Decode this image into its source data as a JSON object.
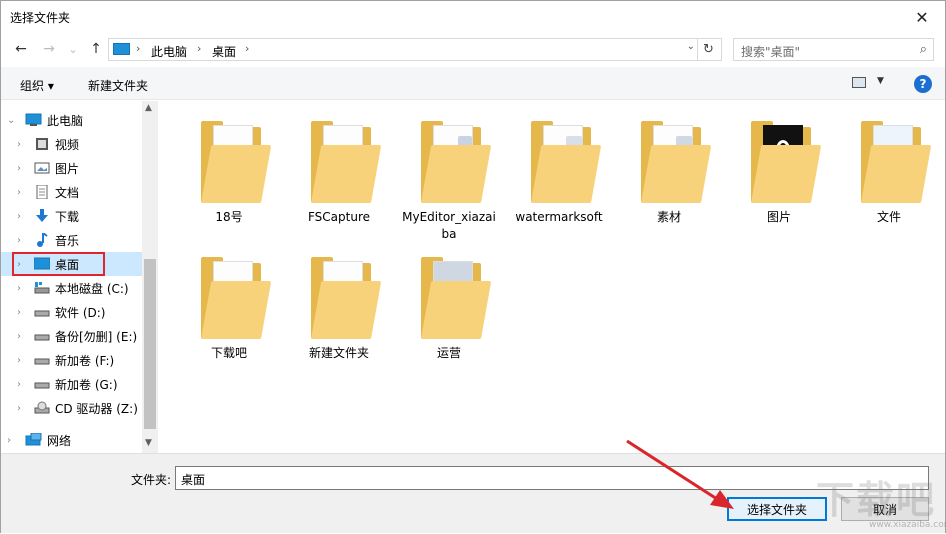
{
  "window": {
    "title": "选择文件夹",
    "close_glyph": "✕"
  },
  "nav": {
    "back_glyph": "←",
    "forward_glyph": "→",
    "recent_glyph": "⌄",
    "up_glyph": "↑",
    "breadcrumb": [
      "此电脑",
      "桌面"
    ],
    "sep_glyph": "›",
    "dropdown_glyph": "⌄",
    "refresh_glyph": "↻"
  },
  "search": {
    "placeholder": "搜索\"桌面\"",
    "icon_glyph": "⌕"
  },
  "toolbar": {
    "organize": "组织 ▾",
    "new_folder": "新建文件夹",
    "view_dropdown_glyph": "▼",
    "help": "?"
  },
  "sidebar": {
    "items": [
      {
        "label": "此电脑",
        "icon": "pc-icon",
        "expanded": true
      },
      {
        "label": "视频",
        "icon": "video-icon"
      },
      {
        "label": "图片",
        "icon": "pictures-icon"
      },
      {
        "label": "文档",
        "icon": "documents-icon"
      },
      {
        "label": "下载",
        "icon": "downloads-icon"
      },
      {
        "label": "音乐",
        "icon": "music-icon"
      },
      {
        "label": "桌面",
        "icon": "desktop-icon",
        "selected": true
      },
      {
        "label": "本地磁盘 (C:)",
        "icon": "drive-c-icon"
      },
      {
        "label": "软件 (D:)",
        "icon": "drive-icon"
      },
      {
        "label": "备份[勿删] (E:)",
        "icon": "drive-icon"
      },
      {
        "label": "新加卷 (F:)",
        "icon": "drive-icon"
      },
      {
        "label": "新加卷 (G:)",
        "icon": "drive-icon"
      },
      {
        "label": "CD 驱动器 (Z:)",
        "icon": "cd-drive-icon"
      },
      {
        "label": "网络",
        "icon": "network-icon"
      }
    ],
    "expand_glyph": "›",
    "collapse_glyph": "⌄",
    "scroll_up_glyph": "▲",
    "scroll_down_glyph": "▼"
  },
  "folders": [
    {
      "label": "18号"
    },
    {
      "label": "FSCapture"
    },
    {
      "label": "MyEditor_xiazaiba"
    },
    {
      "label": "watermarksoft"
    },
    {
      "label": "素材"
    },
    {
      "label": "图片"
    },
    {
      "label": "文件"
    },
    {
      "label": "下载吧"
    },
    {
      "label": "新建文件夹"
    },
    {
      "label": "运营"
    }
  ],
  "bottom": {
    "folder_label": "文件夹:",
    "folder_value": "桌面",
    "select_button": "选择文件夹",
    "cancel_button": "取消"
  },
  "colors": {
    "accent": "#0078d7",
    "highlight": "#e0262b",
    "selection": "#cce8ff"
  }
}
